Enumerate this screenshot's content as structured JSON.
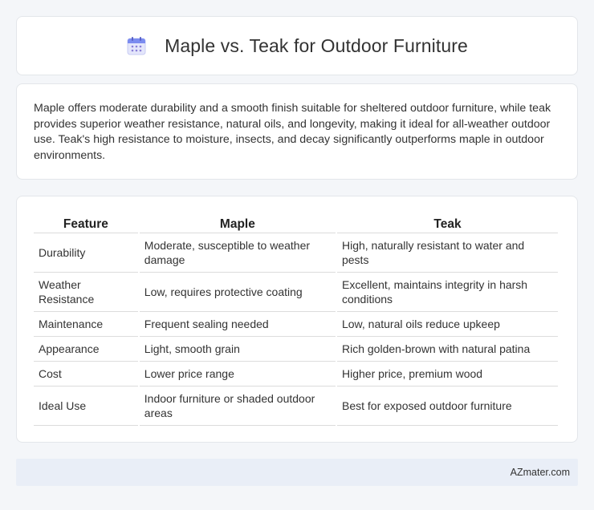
{
  "header": {
    "title": "Maple vs. Teak for Outdoor Furniture",
    "icon": "calendar-icon",
    "icon_color": "#7b7fe8"
  },
  "summary": {
    "text": "Maple offers moderate durability and a smooth finish suitable for sheltered outdoor furniture, while teak provides superior weather resistance, natural oils, and longevity, making it ideal for all-weather outdoor use. Teak's high resistance to moisture, insects, and decay significantly outperforms maple in outdoor environments."
  },
  "table": {
    "headers": [
      "Feature",
      "Maple",
      "Teak"
    ],
    "rows": [
      {
        "feature": "Durability",
        "maple": "Moderate, susceptible to weather damage",
        "teak": "High, naturally resistant to water and pests"
      },
      {
        "feature": "Weather Resistance",
        "maple": "Low, requires protective coating",
        "teak": "Excellent, maintains integrity in harsh conditions"
      },
      {
        "feature": "Maintenance",
        "maple": "Frequent sealing needed",
        "teak": "Low, natural oils reduce upkeep"
      },
      {
        "feature": "Appearance",
        "maple": "Light, smooth grain",
        "teak": "Rich golden-brown with natural patina"
      },
      {
        "feature": "Cost",
        "maple": "Lower price range",
        "teak": "Higher price, premium wood"
      },
      {
        "feature": "Ideal Use",
        "maple": "Indoor furniture or shaded outdoor areas",
        "teak": "Best for exposed outdoor furniture"
      }
    ]
  },
  "footer": {
    "brand": "AZmater.com"
  }
}
